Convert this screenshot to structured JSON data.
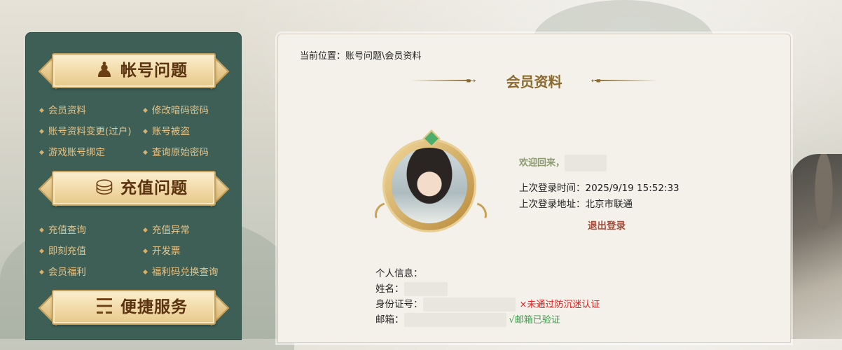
{
  "sidebar": {
    "sections": [
      {
        "title": "帐号问题",
        "icon": "person-icon",
        "items": [
          "会员资料",
          "修改暗码密码",
          "账号资料变更(过户)",
          "账号被盗",
          "游戏账号绑定",
          "查询原始密码"
        ]
      },
      {
        "title": "充值问题",
        "icon": "gold-ingot-icon",
        "items": [
          "充值查询",
          "充值异常",
          "即刻充值",
          "开发票",
          "会员福利",
          "福利码兑换查询"
        ]
      },
      {
        "title": "便捷服务",
        "icon": "tornado-icon",
        "items": []
      }
    ]
  },
  "main": {
    "breadcrumb": "当前位置：账号问题\\会员资料",
    "title": "会员资料",
    "welcome": "欢迎回来，",
    "last_login_time_label": "上次登录时间：",
    "last_login_time": "2025/9/19 15:52:33",
    "last_login_addr_label": "上次登录地址：",
    "last_login_addr": "北京市联通",
    "logout": "退出登录",
    "personal_info": {
      "heading": "个人信息：",
      "name_label": "姓名：",
      "id_label": "身份证号：",
      "id_status": "×未通过防沉迷认证",
      "email_label": "邮箱：",
      "email_status": "√邮箱已验证"
    }
  },
  "colors": {
    "sidebar_bg": "#3d5f56",
    "menu_text": "#e8c488",
    "title_gold": "#8b6a2e",
    "warning": "#e02020",
    "success": "#3a9a4a"
  }
}
